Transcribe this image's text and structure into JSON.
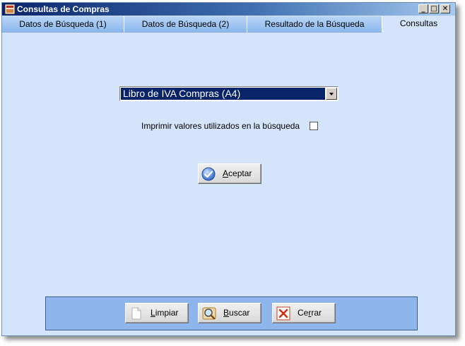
{
  "window": {
    "title": "Consultas de Compras",
    "controls": {
      "minimize": "_",
      "maximize": "□",
      "close": "✕"
    }
  },
  "tabs": [
    {
      "label": "Datos de Búsqueda (1)",
      "active": false
    },
    {
      "label": "Datos de Búsqueda (2)",
      "active": false
    },
    {
      "label": "Resultado de la Búsqueda",
      "active": false
    },
    {
      "label": "Consultas",
      "active": true
    }
  ],
  "report_select": {
    "selected": "Libro de IVA Compras (A4)"
  },
  "print_option": {
    "label": "Imprimir valores utilizados en la búsqueda",
    "checked": false
  },
  "accept_button": {
    "label_prefix": "A",
    "label_rest": "ceptar",
    "icon": "check-icon"
  },
  "bottom_buttons": {
    "limpiar": {
      "label_prefix": "L",
      "label_rest": "impiar",
      "icon": "blank-page-icon"
    },
    "buscar": {
      "label_prefix": "B",
      "label_rest": "uscar",
      "icon": "magnifier-icon"
    },
    "cerrar": {
      "label_prefix": "Ce",
      "label_underline": "r",
      "label_rest": "rar",
      "icon": "close-icon"
    }
  },
  "colors": {
    "title_start": "#0a246a",
    "title_end": "#a6caf0",
    "window_bg": "#d4e4fb",
    "panel_bg": "#8eb5ec",
    "selection": "#0a246a"
  }
}
